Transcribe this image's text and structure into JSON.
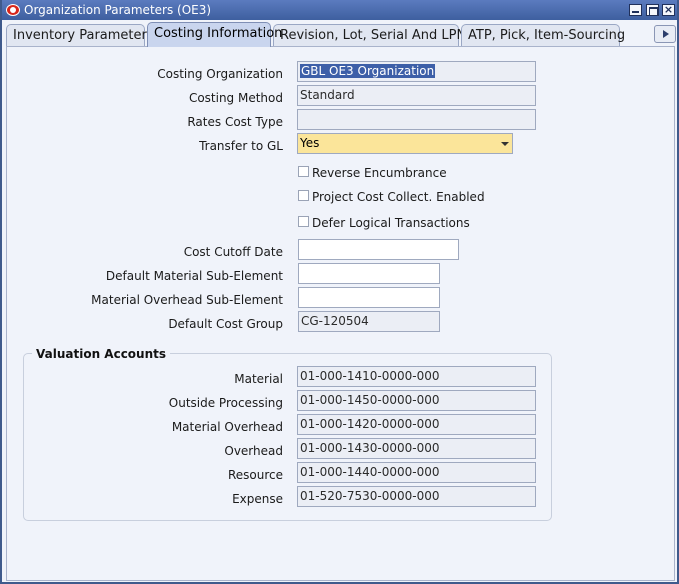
{
  "window": {
    "title": "Organization Parameters (OE3)"
  },
  "tabs": [
    {
      "label": "Inventory Parameters"
    },
    {
      "label": "Costing Information"
    },
    {
      "label": "Revision, Lot, Serial And LPN"
    },
    {
      "label": "ATP, Pick, Item-Sourcing"
    }
  ],
  "form": {
    "costing_org": {
      "label": "Costing Organization",
      "value": "GBL OE3 Organization"
    },
    "costing_method": {
      "label": "Costing Method",
      "value": "Standard"
    },
    "rates_cost_type": {
      "label": "Rates Cost Type",
      "value": ""
    },
    "transfer_to_gl": {
      "label": "Transfer to GL",
      "value": "Yes"
    },
    "reverse_encumbrance": {
      "label": "Reverse Encumbrance"
    },
    "project_cost_collect": {
      "label": "Project Cost Collect. Enabled"
    },
    "defer_logical": {
      "label": "Defer Logical Transactions"
    },
    "cost_cutoff_date": {
      "label": "Cost Cutoff Date",
      "value": ""
    },
    "default_material_sub": {
      "label": "Default Material Sub-Element",
      "value": ""
    },
    "material_overhead_sub": {
      "label": "Material Overhead Sub-Element",
      "value": ""
    },
    "default_cost_group": {
      "label": "Default Cost Group",
      "value": "CG-120504"
    }
  },
  "valuation": {
    "title": "Valuation Accounts",
    "material": {
      "label": "Material",
      "value": "01-000-1410-0000-000"
    },
    "outside_processing": {
      "label": "Outside Processing",
      "value": "01-000-1450-0000-000"
    },
    "material_overhead": {
      "label": "Material Overhead",
      "value": "01-000-1420-0000-000"
    },
    "overhead": {
      "label": "Overhead",
      "value": "01-000-1430-0000-000"
    },
    "resource": {
      "label": "Resource",
      "value": "01-000-1440-0000-000"
    },
    "expense": {
      "label": "Expense",
      "value": "01-520-7530-0000-000"
    }
  }
}
